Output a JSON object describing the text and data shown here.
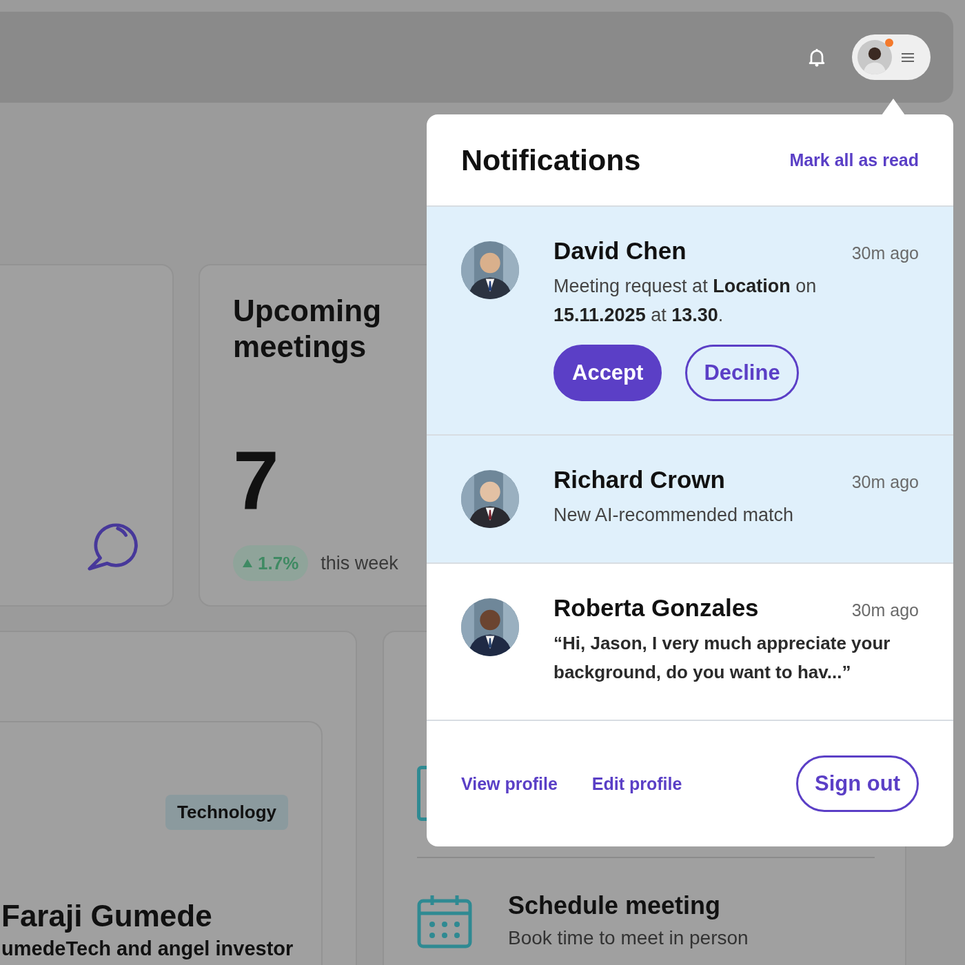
{
  "header": {
    "unread_badge": true
  },
  "dashboard": {
    "stat_card": {
      "title": "Upcoming meetings",
      "value": "7",
      "change": "1.7%",
      "period": "this week"
    },
    "profile_card": {
      "tag": "Technology",
      "name": "Faraji Gumede",
      "subtitle": "umedeTech and angel investor"
    },
    "actions_card": {
      "items": [
        {
          "title": "Schedule meeting",
          "description": "Book time to meet in person"
        }
      ]
    }
  },
  "notifications": {
    "title": "Notifications",
    "mark_all": "Mark all as read",
    "items": [
      {
        "kind": "request",
        "name": "David Chen",
        "time": "30m ago",
        "message": "Meeting request at **Location** on **15.11.2025** at **13.30**.",
        "unread": true,
        "actions": [
          {
            "label": "Accept",
            "kind": "primary"
          },
          {
            "label": "Decline",
            "kind": "outline"
          }
        ]
      },
      {
        "kind": "match",
        "name": "Richard Crown",
        "time": "30m ago",
        "message": "New AI-recommended match",
        "unread": true
      },
      {
        "kind": "quote",
        "name": "Roberta Gonzales",
        "time": "30m ago",
        "message": "“Hi, Jason, I very much appreciate your background, do you want to hav...”",
        "unread": false
      }
    ],
    "footer": {
      "links": [
        "View profile",
        "Edit profile"
      ],
      "button": "Sign out"
    }
  }
}
